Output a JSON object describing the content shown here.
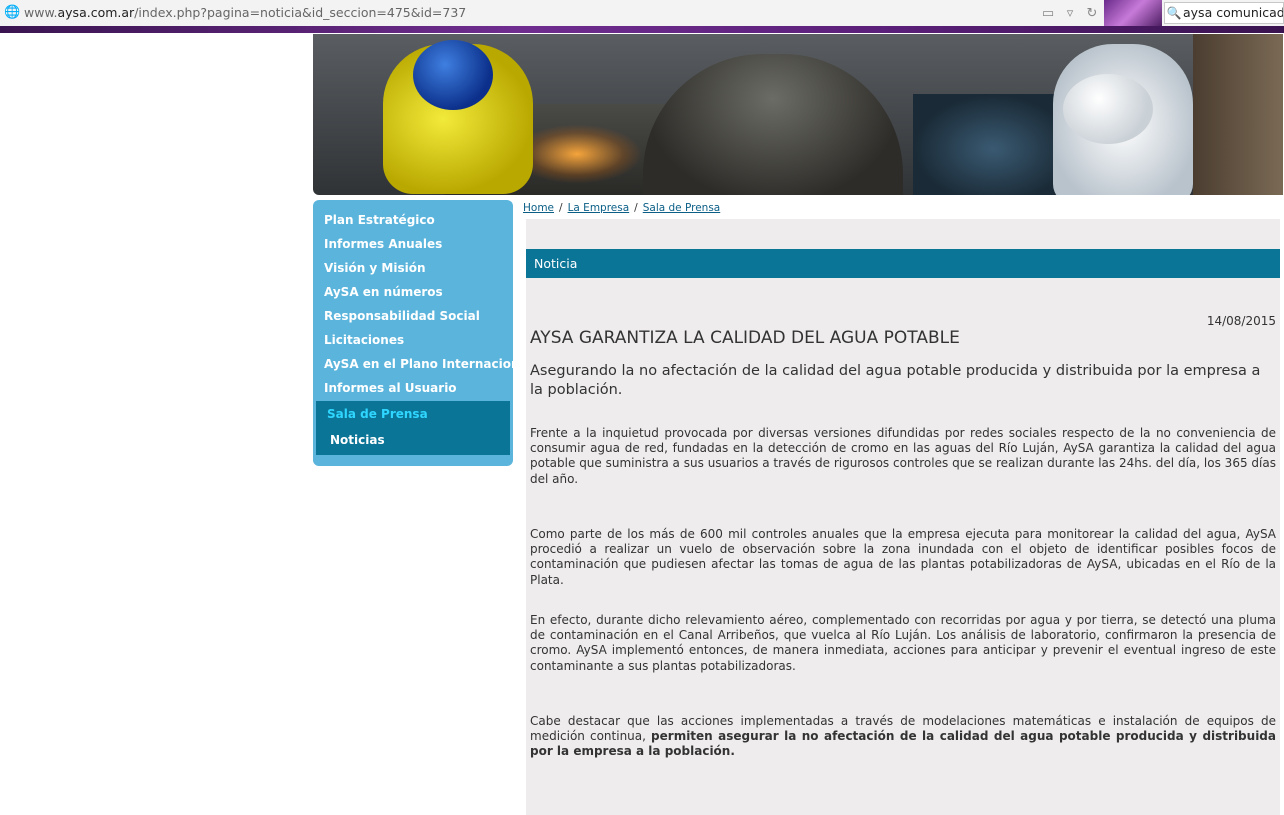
{
  "browser": {
    "url_prefix": "www.",
    "url_host": "aysa.com.ar",
    "url_path": "/index.php?pagina=noticia&id_seccion=475&id=737",
    "search_value": "aysa comunicado"
  },
  "sidebar": {
    "items": [
      {
        "label": "Plan Estratégico"
      },
      {
        "label": "Informes Anuales"
      },
      {
        "label": "Visión y Misión"
      },
      {
        "label": "AySA en números"
      },
      {
        "label": "Responsabilidad Social"
      },
      {
        "label": "Licitaciones"
      },
      {
        "label": "AySA en el Plano Internacional"
      },
      {
        "label": "Informes al Usuario"
      }
    ],
    "active_section": "Sala de Prensa",
    "active_child": "Noticias"
  },
  "breadcrumb": {
    "items": [
      "Home",
      "La Empresa",
      "Sala de Prensa"
    ],
    "separator": "/"
  },
  "article": {
    "section_label": "Noticia",
    "date": "14/08/2015",
    "title": "AYSA GARANTIZA LA CALIDAD DEL AGUA POTABLE",
    "subtitle": "Asegurando la no afectación de la calidad del agua potable producida y distribuida por la empresa a la población.",
    "paragraph_1": "Frente a la inquietud provocada por diversas versiones difundidas por redes sociales respecto de la no conveniencia de consumir agua de red, fundadas en la detección de cromo en las aguas del Río Luján, AySA garantiza la calidad del agua potable que suministra a sus usuarios a través de rigurosos controles que se realizan durante las 24hs. del día, los 365 días del año.",
    "paragraph_2": "Como parte de los más de 600 mil controles anuales que la empresa ejecuta para monitorear la calidad del agua, AySA procedió a realizar un vuelo de observación sobre la zona inundada con el objeto de identificar posibles focos de contaminación que pudiesen afectar las tomas de agua de las plantas potabilizadoras de AySA, ubicadas en el Río de la Plata.",
    "paragraph_3": "En efecto, durante dicho relevamiento aéreo, complementado con recorridas por agua y por tierra, se detectó una pluma de contaminación en el Canal Arribeños, que vuelca al Río Luján. Los análisis de laboratorio, confirmaron la presencia de cromo. AySA implementó entonces, de manera inmediata, acciones para anticipar y prevenir el eventual ingreso de este contaminante a sus plantas potabilizadoras.",
    "paragraph_4_plain": "Cabe destacar que las acciones implementadas a través de modelaciones matemáticas e instalación de equipos de medición continua, ",
    "paragraph_4_bold": "permiten asegurar la no afectación de la calidad del agua potable producida y distribuida por la empresa a la población."
  },
  "colors": {
    "sidebar_bg": "#5ab4dc",
    "sidebar_active_bg": "#0b7598",
    "sidebar_active_text": "#2fd6ff",
    "notice_bar_bg": "#0b7598",
    "content_bg": "#eeeced"
  }
}
